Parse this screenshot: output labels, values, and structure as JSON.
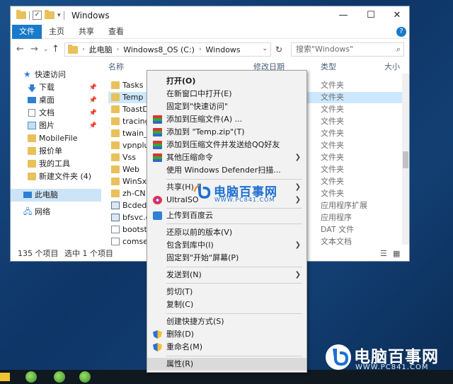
{
  "window": {
    "title": "Windows",
    "controls": {
      "minimize": "—",
      "maximize": "☐",
      "close": "✕"
    }
  },
  "ribbon": {
    "tabs": [
      {
        "label": "文件",
        "active": true
      },
      {
        "label": "主页",
        "active": false
      },
      {
        "label": "共享",
        "active": false
      },
      {
        "label": "查看",
        "active": false
      }
    ],
    "help": "?"
  },
  "address": {
    "crumbs": [
      "此电脑",
      "Windows8_OS (C:)",
      "Windows"
    ],
    "search_placeholder": "搜索\"Windows\""
  },
  "nav": {
    "items": [
      {
        "label": "快速访问",
        "icon": "star-icon"
      },
      {
        "label": "下载",
        "icon": "download-icon",
        "pinned": true
      },
      {
        "label": "桌面",
        "icon": "desktop-icon",
        "pinned": true
      },
      {
        "label": "文档",
        "icon": "document-icon",
        "pinned": true
      },
      {
        "label": "图片",
        "icon": "picture-icon",
        "pinned": true
      },
      {
        "label": "MobileFile",
        "icon": "folder-icon"
      },
      {
        "label": "报价单",
        "icon": "folder-icon"
      },
      {
        "label": "我的工具",
        "icon": "folder-icon"
      },
      {
        "label": "新建文件夹 (4)",
        "icon": "folder-icon"
      },
      {
        "label": "此电脑",
        "icon": "computer-icon",
        "selected": true
      },
      {
        "label": "网络",
        "icon": "network-icon"
      }
    ]
  },
  "list": {
    "columns": {
      "name": "名称",
      "modified": "修改日期",
      "type": "类型",
      "size": "大小"
    },
    "rows": [
      {
        "name": "Tasks",
        "type": "文件夹",
        "kind": "folder"
      },
      {
        "name": "Temp",
        "type": "文件夹",
        "kind": "folder",
        "selected": true
      },
      {
        "name": "ToastData",
        "type": "文件夹",
        "kind": "folder"
      },
      {
        "name": "tracing",
        "type": "文件夹",
        "kind": "folder"
      },
      {
        "name": "twain_32",
        "type": "文件夹",
        "kind": "folder"
      },
      {
        "name": "vpnplugins",
        "type": "文件夹",
        "kind": "folder"
      },
      {
        "name": "Vss",
        "type": "文件夹",
        "kind": "folder"
      },
      {
        "name": "Web",
        "type": "文件夹",
        "kind": "folder"
      },
      {
        "name": "WinSxS",
        "type": "文件夹",
        "kind": "folder"
      },
      {
        "name": "zh-CN",
        "type": "文件夹",
        "kind": "folder"
      },
      {
        "name": "Bcdedit.exe",
        "type": "应用程序扩展",
        "kind": "app"
      },
      {
        "name": "bfsvc.exe",
        "type": "应用程序",
        "kind": "app"
      },
      {
        "name": "bootstat.dat",
        "type": "DAT 文件",
        "kind": "doc"
      },
      {
        "name": "comsetup.log",
        "type": "文本文档",
        "kind": "doc"
      }
    ]
  },
  "status": {
    "count": "135 个项目",
    "selected": "选中 1 个项目"
  },
  "context_menu": {
    "items": [
      {
        "label": "打开(O)",
        "bold": true
      },
      {
        "label": "在新窗口中打开(E)"
      },
      {
        "label": "固定到\"快速访问\""
      },
      {
        "label": "添加到压缩文件(A) ...",
        "icon": "winrar-icon"
      },
      {
        "label": "添加到 \"Temp.zip\"(T)",
        "icon": "winrar-icon"
      },
      {
        "label": "添加到压缩文件并发送给QQ好友",
        "icon": "winrar-icon"
      },
      {
        "label": "其他压缩命令",
        "icon": "winrar-icon",
        "submenu": true
      },
      {
        "label": "使用 Windows Defender扫描...",
        "sep_after": true
      },
      {
        "label": "共享(H)",
        "submenu": true
      },
      {
        "label": "UltraISO",
        "icon": "ultraiso-icon",
        "submenu": true,
        "sep_after": true
      },
      {
        "label": "上传到百度云",
        "icon": "baidu-cloud-icon",
        "sep_after": true
      },
      {
        "label": "还原以前的版本(V)"
      },
      {
        "label": "包含到库中(I)",
        "submenu": true
      },
      {
        "label": "固定到\"开始\"屏幕(P)",
        "sep_after": true
      },
      {
        "label": "发送到(N)",
        "submenu": true,
        "sep_after": true
      },
      {
        "label": "剪切(T)"
      },
      {
        "label": "复制(C)",
        "sep_after": true
      },
      {
        "label": "创建快捷方式(S)"
      },
      {
        "label": "删除(D)",
        "icon": "shield-icon"
      },
      {
        "label": "重命名(M)",
        "icon": "shield-icon",
        "sep_after": true
      },
      {
        "label": "属性(R)",
        "highlight": true
      }
    ],
    "submenu_arrow": "❯"
  },
  "watermark": {
    "title": "电脑百事网",
    "url": "WWW.PC841.COM"
  },
  "brand": {
    "title": "电脑百事网",
    "url": "WWW.PC841.COM"
  },
  "colors": {
    "accent": "#1979ca",
    "folder": "#e9c15a",
    "selection": "#cce8ff"
  }
}
